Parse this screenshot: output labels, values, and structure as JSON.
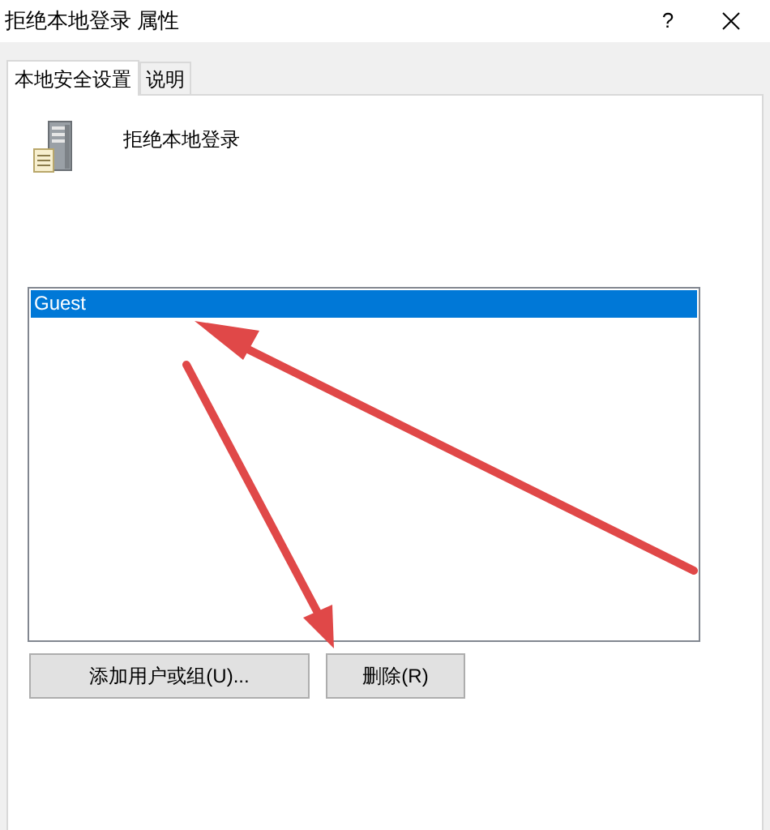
{
  "window": {
    "title": "拒绝本地登录 属性",
    "help": "?"
  },
  "tabs": [
    {
      "label": "本地安全设置",
      "selected": true
    },
    {
      "label": "说明",
      "selected": false
    }
  ],
  "policy": {
    "name": "拒绝本地登录"
  },
  "list": {
    "items": [
      {
        "label": "Guest",
        "selected": true
      }
    ]
  },
  "buttons": [
    {
      "label": "添加用户或组(U)..."
    },
    {
      "label": "删除(R)"
    }
  ]
}
